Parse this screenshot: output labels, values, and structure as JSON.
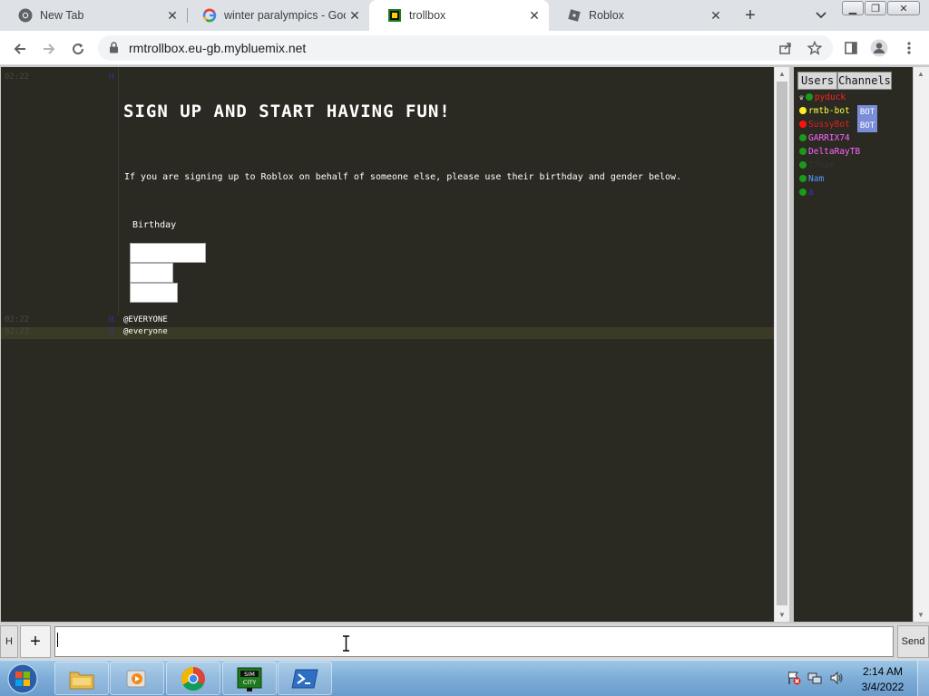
{
  "browser": {
    "tabs": [
      {
        "title": "New Tab",
        "icon": "chrome-icon"
      },
      {
        "title": "winter paralympics - Goo",
        "icon": "google-icon"
      },
      {
        "title": "trollbox",
        "icon": "trollbox-icon"
      },
      {
        "title": "Roblox",
        "icon": "roblox-icon"
      }
    ],
    "url": "rmtrollbox.eu-gb.mybluemix.net"
  },
  "chat": {
    "title": "SIGN UP AND START HAVING FUN!",
    "notice": "If you are signing up to Roblox on behalf of someone else, please use their birthday and gender below.",
    "birthday_label": "Birthday",
    "messages": [
      {
        "time": "02:22",
        "nick": "H",
        "text": ""
      },
      {
        "time": "02:22",
        "nick": "H",
        "text": "@EVERYONE"
      },
      {
        "time": "02:23",
        "nick": "H",
        "text": "@everyone"
      }
    ]
  },
  "sidebar": {
    "tab_users": "Users",
    "tab_channels": "Channels",
    "users": [
      {
        "name": "pyduck",
        "color": "#ff2020",
        "dot": "#1a9a1a"
      },
      {
        "name": "rmtb-bot",
        "color": "#ffff40",
        "dot": "#ffee22",
        "badge": "BOT"
      },
      {
        "name": "SussyBot",
        "color": "#e02020",
        "dot": "#ff1010",
        "badge": "BOT"
      },
      {
        "name": "GARRIX74",
        "color": "#ff66ff",
        "dot": "#1a9a1a"
      },
      {
        "name": "DeltaRayTB",
        "color": "#ff66ff",
        "dot": "#1a9a1a"
      },
      {
        "name": "ITham",
        "color": "#333333",
        "dot": "#1a9a1a"
      },
      {
        "name": "Nam",
        "color": "#5599ff",
        "dot": "#1a9a1a"
      },
      {
        "name": "a",
        "color": "#3333cc",
        "dot": "#1a9a1a"
      }
    ]
  },
  "input": {
    "h_label": "H",
    "plus_label": "+",
    "send_label": "Send"
  },
  "taskbar": {
    "time": "2:14 AM",
    "date": "3/4/2022",
    "apps": [
      "file-explorer-icon",
      "media-player-icon",
      "chrome-icon",
      "simcity-icon",
      "powershell-icon"
    ]
  }
}
